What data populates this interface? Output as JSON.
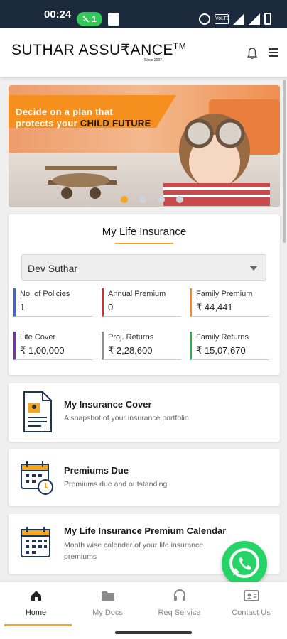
{
  "status_bar": {
    "time": "00:24",
    "call_count": "1",
    "volte": "VoLTE"
  },
  "header": {
    "brand": "SUTHAR ASSU₹ANCE",
    "trademark": "TM",
    "since": "Since 2007"
  },
  "banner": {
    "line1": "Decide on a plan that",
    "line2_prefix": "protects your ",
    "line2_highlight": "CHILD FUTURE",
    "dots": 4,
    "active_dot": 0,
    "accent": "#f5a623"
  },
  "life_insurance": {
    "title": "My Life Insurance",
    "selected_member": "Dev Suthar",
    "metrics": [
      {
        "label": "No. of Policies",
        "value": "1",
        "color": "blue"
      },
      {
        "label": "Annual Premium",
        "value": "0",
        "color": "red"
      },
      {
        "label": "Family Premium",
        "value": "₹ 44,441",
        "color": "orange"
      },
      {
        "label": "Life Cover",
        "value": "₹ 1,00,000",
        "color": "purple"
      },
      {
        "label": "Proj. Returns",
        "value": "₹ 2,28,600",
        "color": "gray"
      },
      {
        "label": "Family Returns",
        "value": "₹ 15,07,670",
        "color": "green"
      }
    ]
  },
  "menu_cards": [
    {
      "title": "My Insurance Cover",
      "subtitle": "A snapshot of your insurance portfolio",
      "icon": "document-icon"
    },
    {
      "title": "Premiums Due",
      "subtitle": "Premiums due and outstanding",
      "icon": "calendar-clock-icon"
    },
    {
      "title": "My Life Insurance Premium Calendar",
      "subtitle": "Month wise calendar of your life insurance premiums",
      "icon": "calendar-icon"
    }
  ],
  "bottom_nav": [
    {
      "label": "Home",
      "icon": "home-icon",
      "active": true
    },
    {
      "label": "My Docs",
      "icon": "folder-icon",
      "active": false
    },
    {
      "label": "Req Service",
      "icon": "headset-icon",
      "active": false
    },
    {
      "label": "Contact Us",
      "icon": "contact-card-icon",
      "active": false
    }
  ]
}
